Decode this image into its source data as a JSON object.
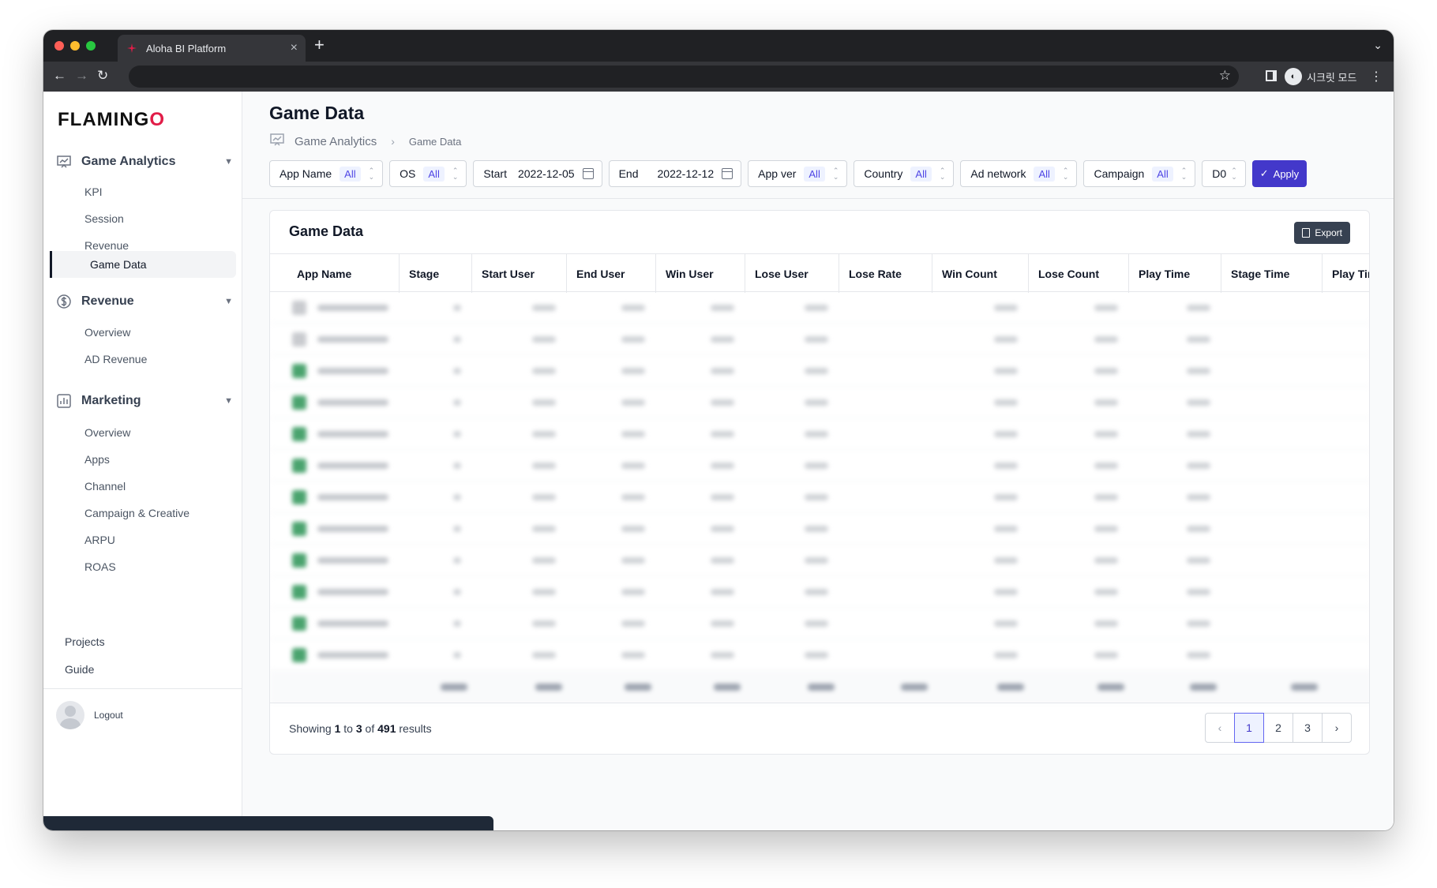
{
  "browser": {
    "tab_title": "Aloha BI Platform",
    "tab_close": "×",
    "new_tab": "+",
    "incognito_label": "시크릿 모드"
  },
  "sidebar": {
    "logo_text": "FLAMING",
    "logo_accent": "O",
    "sections": [
      {
        "label": "Game Analytics",
        "icon": "chart-presentation-icon",
        "items": [
          "KPI",
          "Session",
          "Revenue",
          "Game Data"
        ]
      },
      {
        "label": "Revenue",
        "icon": "dollar-circle-icon",
        "items": [
          "Overview",
          "AD Revenue"
        ]
      },
      {
        "label": "Marketing",
        "icon": "bar-chart-icon",
        "items": [
          "Overview",
          "Apps",
          "Channel",
          "Campaign & Creative",
          "ARPU",
          "ROAS"
        ]
      }
    ],
    "active_item": "Game Data",
    "bottom_links": [
      "Projects",
      "Guide"
    ],
    "logout_label": "Logout"
  },
  "page": {
    "title": "Game Data",
    "breadcrumb": [
      "Game Analytics",
      "Game Data"
    ]
  },
  "filters": [
    {
      "label": "App Name",
      "value": "All"
    },
    {
      "label": "OS",
      "value": "All"
    },
    {
      "label": "Start",
      "date": "2022-12-05"
    },
    {
      "label": "End",
      "date": "2022-12-12"
    },
    {
      "label": "App ver",
      "value": "All"
    },
    {
      "label": "Country",
      "value": "All"
    },
    {
      "label": "Ad network",
      "value": "All"
    },
    {
      "label": "Campaign",
      "value": "All"
    },
    {
      "label": "D0"
    }
  ],
  "apply_label": "Apply",
  "card": {
    "title": "Game Data",
    "export_label": "Export"
  },
  "table": {
    "columns": [
      "App Name",
      "Stage",
      "Start User",
      "End User",
      "Win User",
      "Lose User",
      "Lose Rate",
      "Win Count",
      "Lose Count",
      "Play Time",
      "Stage Time",
      "Play Time"
    ]
  },
  "footer": {
    "showing_prefix": "Showing ",
    "from": "1",
    "to_word": " to ",
    "to": "3",
    "of_word": " of ",
    "total": "491",
    "results_word": " results",
    "pages": [
      "1",
      "2",
      "3"
    ],
    "active_page": "1",
    "prev": "‹",
    "next": "›"
  },
  "colors": {
    "accent": "#4338ca",
    "brand_logo_accent": "#e11d48",
    "active_nav_border": "#111827"
  }
}
